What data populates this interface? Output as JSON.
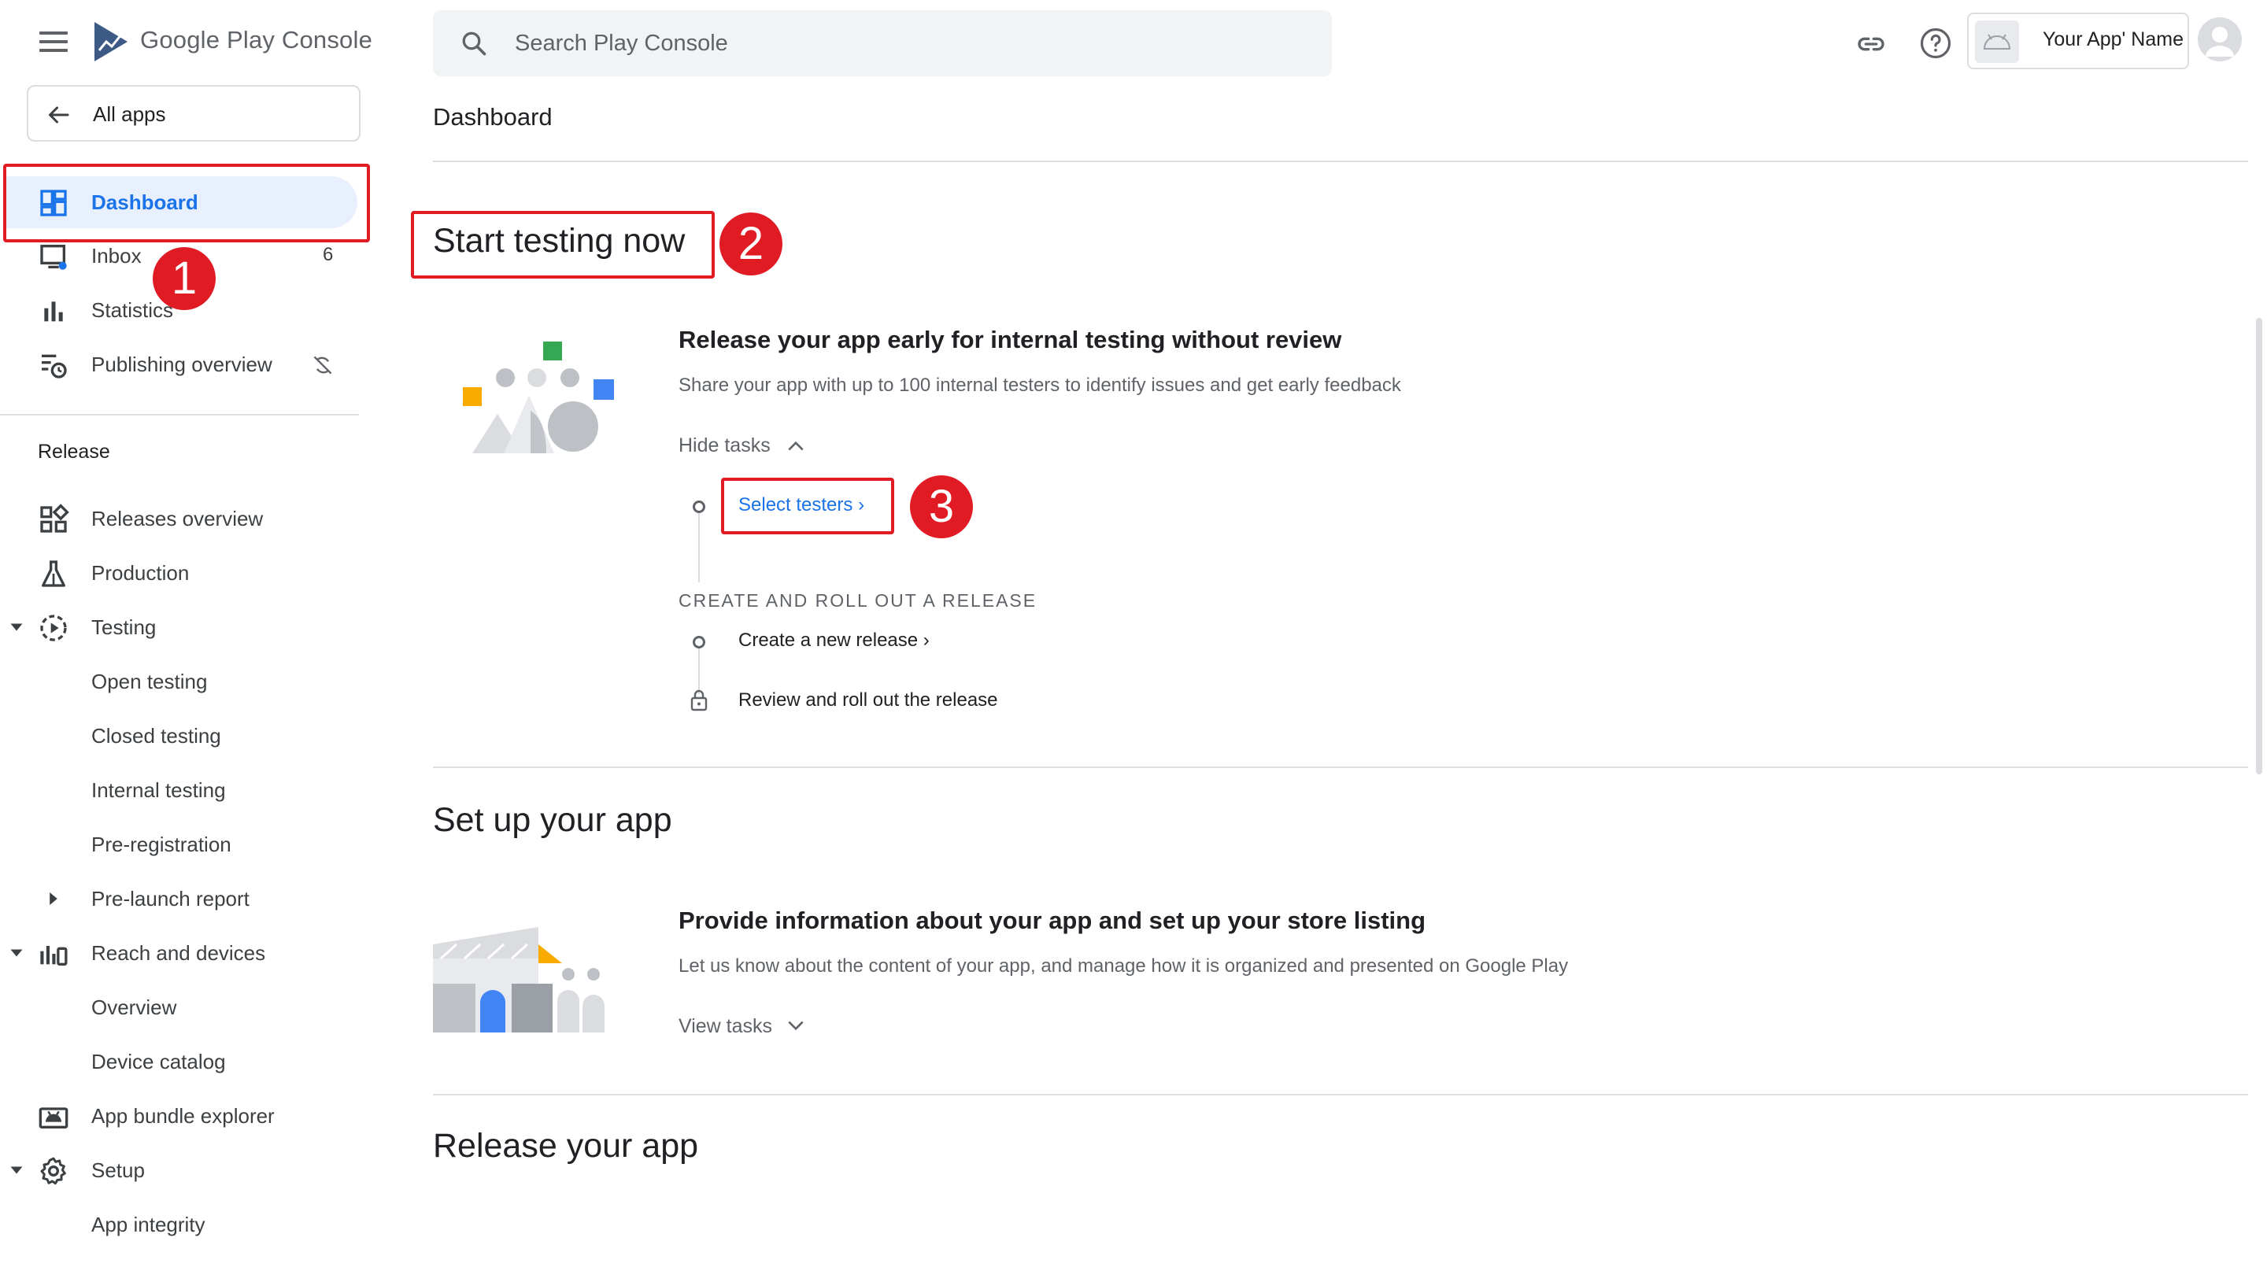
{
  "topbar": {
    "brand": "Google Play Console",
    "search_placeholder": "Search Play Console",
    "app_name": "Your App' Name"
  },
  "sidebar": {
    "all_apps_label": "All apps",
    "items": [
      {
        "label": "Dashboard"
      },
      {
        "label": "Inbox",
        "count": "6"
      },
      {
        "label": "Statistics"
      },
      {
        "label": "Publishing overview"
      }
    ],
    "release_section_title": "Release",
    "release_items": [
      {
        "label": "Releases overview"
      },
      {
        "label": "Production"
      },
      {
        "label": "Testing"
      },
      {
        "label": "Open testing"
      },
      {
        "label": "Closed testing"
      },
      {
        "label": "Internal testing"
      },
      {
        "label": "Pre-registration"
      },
      {
        "label": "Pre-launch report"
      },
      {
        "label": "Reach and devices"
      },
      {
        "label": "Overview"
      },
      {
        "label": "Device catalog"
      },
      {
        "label": "App bundle explorer"
      },
      {
        "label": "Setup"
      },
      {
        "label": "App integrity"
      }
    ]
  },
  "main": {
    "page_title": "Dashboard",
    "sections": [
      {
        "heading": "Start testing now",
        "card_title": "Release your app early for internal testing without review",
        "card_desc": "Share your app with up to 100 internal testers to identify issues and get early feedback",
        "toggle_label": "Hide tasks",
        "task_select_testers": "Select testers",
        "subsection_label": "CREATE AND ROLL OUT A RELEASE",
        "task_create_release": "Create a new release",
        "task_review_rollout": "Review and roll out the release"
      },
      {
        "heading": "Set up your app",
        "card_title": "Provide information about your app and set up your store listing",
        "card_desc": "Let us know about the content of your app, and manage how it is organized and presented on Google Play",
        "toggle_label": "View tasks"
      },
      {
        "heading": "Release your app"
      }
    ]
  },
  "annotations": {
    "marker_1": "1",
    "marker_2": "2",
    "marker_3": "3",
    "marker_color": "#e01b24"
  },
  "colors": {
    "accent": "#1a73e8",
    "active_nav_bg": "#e8f0fe",
    "text": "#202124",
    "muted": "#5f6368"
  }
}
